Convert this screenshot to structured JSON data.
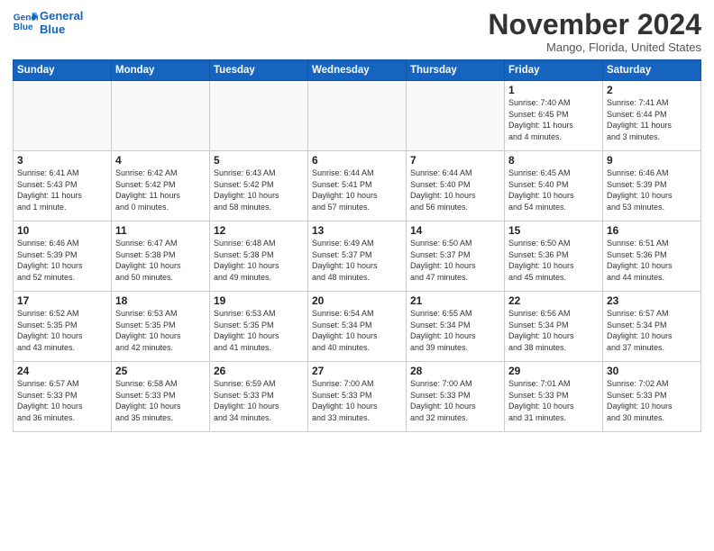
{
  "header": {
    "logo_line1": "General",
    "logo_line2": "Blue",
    "month_title": "November 2024",
    "subtitle": "Mango, Florida, United States"
  },
  "weekdays": [
    "Sunday",
    "Monday",
    "Tuesday",
    "Wednesday",
    "Thursday",
    "Friday",
    "Saturday"
  ],
  "weeks": [
    [
      {
        "day": "",
        "info": ""
      },
      {
        "day": "",
        "info": ""
      },
      {
        "day": "",
        "info": ""
      },
      {
        "day": "",
        "info": ""
      },
      {
        "day": "",
        "info": ""
      },
      {
        "day": "1",
        "info": "Sunrise: 7:40 AM\nSunset: 6:45 PM\nDaylight: 11 hours\nand 4 minutes."
      },
      {
        "day": "2",
        "info": "Sunrise: 7:41 AM\nSunset: 6:44 PM\nDaylight: 11 hours\nand 3 minutes."
      }
    ],
    [
      {
        "day": "3",
        "info": "Sunrise: 6:41 AM\nSunset: 5:43 PM\nDaylight: 11 hours\nand 1 minute."
      },
      {
        "day": "4",
        "info": "Sunrise: 6:42 AM\nSunset: 5:42 PM\nDaylight: 11 hours\nand 0 minutes."
      },
      {
        "day": "5",
        "info": "Sunrise: 6:43 AM\nSunset: 5:42 PM\nDaylight: 10 hours\nand 58 minutes."
      },
      {
        "day": "6",
        "info": "Sunrise: 6:44 AM\nSunset: 5:41 PM\nDaylight: 10 hours\nand 57 minutes."
      },
      {
        "day": "7",
        "info": "Sunrise: 6:44 AM\nSunset: 5:40 PM\nDaylight: 10 hours\nand 56 minutes."
      },
      {
        "day": "8",
        "info": "Sunrise: 6:45 AM\nSunset: 5:40 PM\nDaylight: 10 hours\nand 54 minutes."
      },
      {
        "day": "9",
        "info": "Sunrise: 6:46 AM\nSunset: 5:39 PM\nDaylight: 10 hours\nand 53 minutes."
      }
    ],
    [
      {
        "day": "10",
        "info": "Sunrise: 6:46 AM\nSunset: 5:39 PM\nDaylight: 10 hours\nand 52 minutes."
      },
      {
        "day": "11",
        "info": "Sunrise: 6:47 AM\nSunset: 5:38 PM\nDaylight: 10 hours\nand 50 minutes."
      },
      {
        "day": "12",
        "info": "Sunrise: 6:48 AM\nSunset: 5:38 PM\nDaylight: 10 hours\nand 49 minutes."
      },
      {
        "day": "13",
        "info": "Sunrise: 6:49 AM\nSunset: 5:37 PM\nDaylight: 10 hours\nand 48 minutes."
      },
      {
        "day": "14",
        "info": "Sunrise: 6:50 AM\nSunset: 5:37 PM\nDaylight: 10 hours\nand 47 minutes."
      },
      {
        "day": "15",
        "info": "Sunrise: 6:50 AM\nSunset: 5:36 PM\nDaylight: 10 hours\nand 45 minutes."
      },
      {
        "day": "16",
        "info": "Sunrise: 6:51 AM\nSunset: 5:36 PM\nDaylight: 10 hours\nand 44 minutes."
      }
    ],
    [
      {
        "day": "17",
        "info": "Sunrise: 6:52 AM\nSunset: 5:35 PM\nDaylight: 10 hours\nand 43 minutes."
      },
      {
        "day": "18",
        "info": "Sunrise: 6:53 AM\nSunset: 5:35 PM\nDaylight: 10 hours\nand 42 minutes."
      },
      {
        "day": "19",
        "info": "Sunrise: 6:53 AM\nSunset: 5:35 PM\nDaylight: 10 hours\nand 41 minutes."
      },
      {
        "day": "20",
        "info": "Sunrise: 6:54 AM\nSunset: 5:34 PM\nDaylight: 10 hours\nand 40 minutes."
      },
      {
        "day": "21",
        "info": "Sunrise: 6:55 AM\nSunset: 5:34 PM\nDaylight: 10 hours\nand 39 minutes."
      },
      {
        "day": "22",
        "info": "Sunrise: 6:56 AM\nSunset: 5:34 PM\nDaylight: 10 hours\nand 38 minutes."
      },
      {
        "day": "23",
        "info": "Sunrise: 6:57 AM\nSunset: 5:34 PM\nDaylight: 10 hours\nand 37 minutes."
      }
    ],
    [
      {
        "day": "24",
        "info": "Sunrise: 6:57 AM\nSunset: 5:33 PM\nDaylight: 10 hours\nand 36 minutes."
      },
      {
        "day": "25",
        "info": "Sunrise: 6:58 AM\nSunset: 5:33 PM\nDaylight: 10 hours\nand 35 minutes."
      },
      {
        "day": "26",
        "info": "Sunrise: 6:59 AM\nSunset: 5:33 PM\nDaylight: 10 hours\nand 34 minutes."
      },
      {
        "day": "27",
        "info": "Sunrise: 7:00 AM\nSunset: 5:33 PM\nDaylight: 10 hours\nand 33 minutes."
      },
      {
        "day": "28",
        "info": "Sunrise: 7:00 AM\nSunset: 5:33 PM\nDaylight: 10 hours\nand 32 minutes."
      },
      {
        "day": "29",
        "info": "Sunrise: 7:01 AM\nSunset: 5:33 PM\nDaylight: 10 hours\nand 31 minutes."
      },
      {
        "day": "30",
        "info": "Sunrise: 7:02 AM\nSunset: 5:33 PM\nDaylight: 10 hours\nand 30 minutes."
      }
    ]
  ]
}
